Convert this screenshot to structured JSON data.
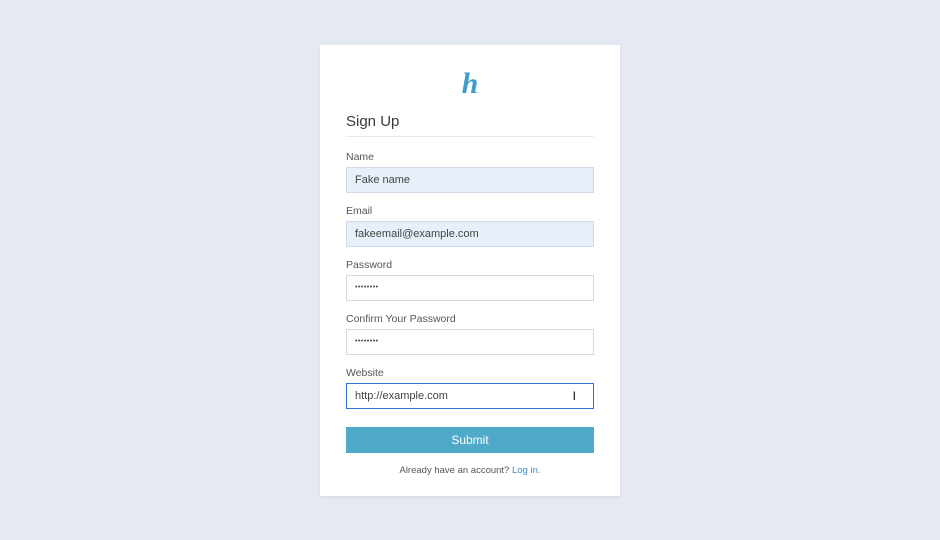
{
  "logo_text": "h",
  "page_title": "Sign Up",
  "fields": {
    "name": {
      "label": "Name",
      "value": "Fake name"
    },
    "email": {
      "label": "Email",
      "value": "fakeemail@example.com"
    },
    "password": {
      "label": "Password",
      "value": "••••••••"
    },
    "confirm_password": {
      "label": "Confirm Your Password",
      "value": "••••••••"
    },
    "website": {
      "label": "Website",
      "value": "http://example.com"
    }
  },
  "submit_label": "Submit",
  "footer": {
    "text": "Already have an account? ",
    "link_text": "Log in."
  }
}
